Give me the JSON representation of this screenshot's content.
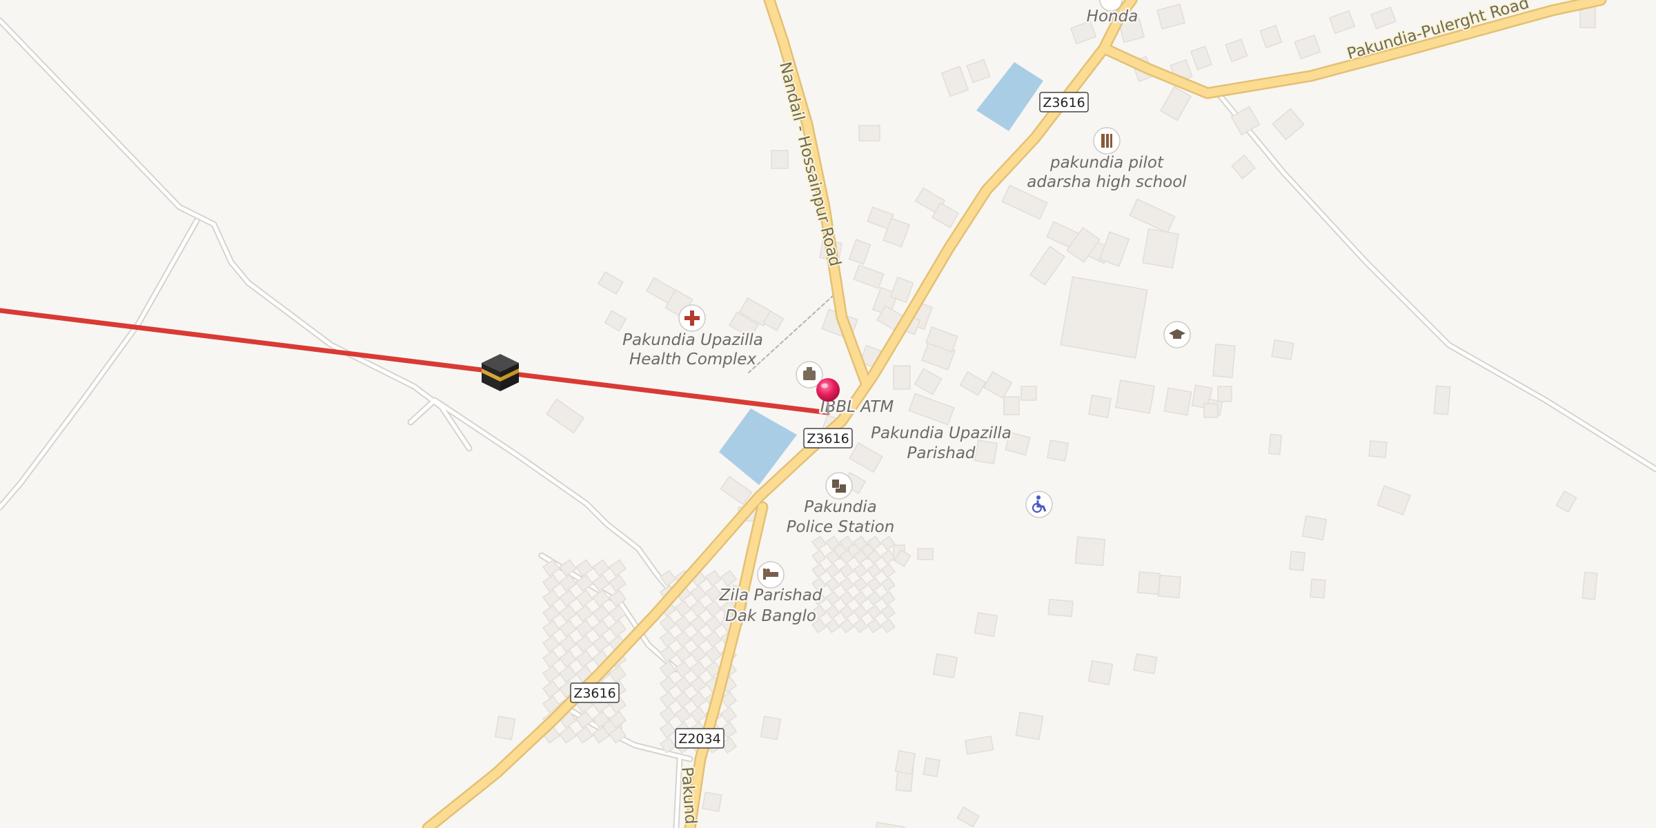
{
  "map": {
    "roads": [
      {
        "name": "Nandail - Hossainpur Road"
      },
      {
        "name": "Pakundia-Pulerght Road"
      },
      {
        "name": "Pakund"
      }
    ],
    "road_shields": [
      "Z3616",
      "Z3616",
      "Z3616",
      "Z2034"
    ],
    "pois": [
      {
        "name_line1": "Honda",
        "icon": "car-icon"
      },
      {
        "name_line1": "pakundia pilot",
        "name_line2": "adarsha high school",
        "icon": "school-icon"
      },
      {
        "name_line1": "Pakundia Upazilla",
        "name_line2": "Health Complex",
        "icon": "hospital-cross-icon"
      },
      {
        "name_line1": "IBBL ATM",
        "icon": "atm-icon"
      },
      {
        "name_line1": "Pakundia Upazilla",
        "name_line2": "Parishad"
      },
      {
        "name_line1": "Pakundia",
        "name_line2": "Police Station",
        "icon": "police-icon"
      },
      {
        "name_line1": "Zila Parishad",
        "name_line2": "Dak Banglo",
        "icon": "bed-icon"
      }
    ],
    "other_icons": [
      "graduation-cap-icon",
      "wheelchair-icon",
      "kaaba-icon",
      "location-pin-icon"
    ],
    "colors": {
      "background": "#f8f6f3",
      "major_road": "#fbdc92",
      "road_casing": "#e3c074",
      "minor_road": "#ffffff",
      "water": "#aacde6",
      "building": "#efebe6",
      "qibla_line": "#d93a34",
      "pin": "#e8205e"
    }
  }
}
